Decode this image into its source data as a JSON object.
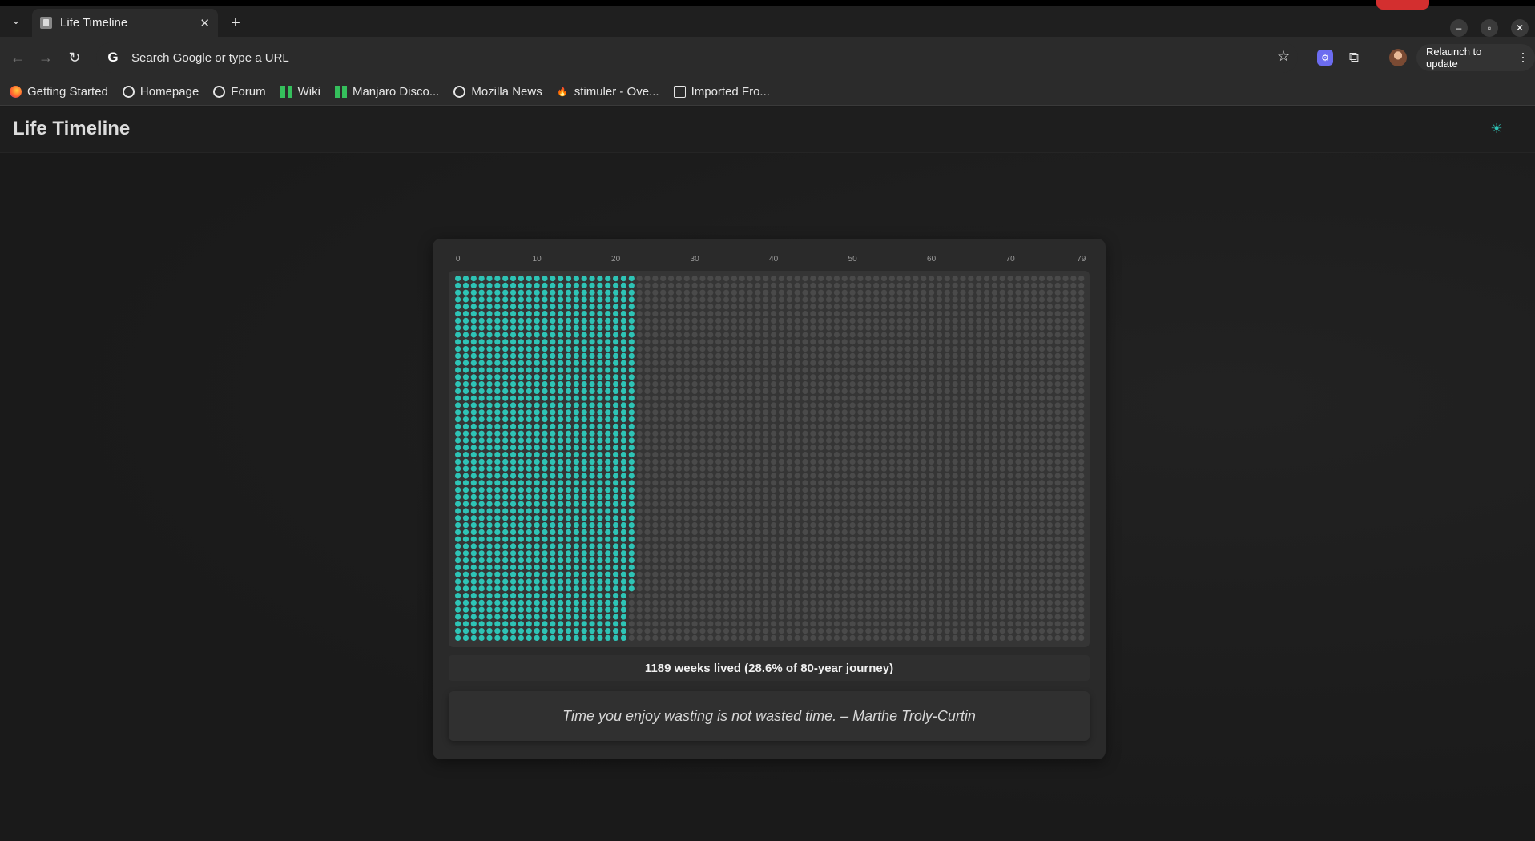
{
  "browser": {
    "tab_title": "Life Timeline",
    "omnibox_placeholder": "Search Google or type a URL",
    "relaunch_label": "Relaunch to update",
    "bookmarks": [
      {
        "label": "Getting Started",
        "icon": "firefox-icon"
      },
      {
        "label": "Homepage",
        "icon": "globe-icon"
      },
      {
        "label": "Forum",
        "icon": "globe-icon"
      },
      {
        "label": "Wiki",
        "icon": "manjaro-icon"
      },
      {
        "label": "Manjaro Disco...",
        "icon": "manjaro-icon"
      },
      {
        "label": "Mozilla News",
        "icon": "globe-icon"
      },
      {
        "label": "stimuler - Ove...",
        "icon": "fire-icon"
      },
      {
        "label": "Imported Fro...",
        "icon": "folder-icon"
      }
    ]
  },
  "app": {
    "title": "Life Timeline",
    "theme_icon": "sun-icon"
  },
  "timeline": {
    "axis_ticks": [
      "0",
      "10",
      "20",
      "30",
      "40",
      "50",
      "60",
      "70",
      "79"
    ],
    "total_years": 80,
    "weeks_per_year": 52,
    "weeks_lived": 1189,
    "lived_color": "#2ec4b6",
    "remaining_color": "#4a4a4a",
    "stats_text": "1189 weeks lived (28.6% of 80-year journey)",
    "quote": "Time you enjoy wasting is not wasted time. – Marthe Troly-Curtin"
  }
}
